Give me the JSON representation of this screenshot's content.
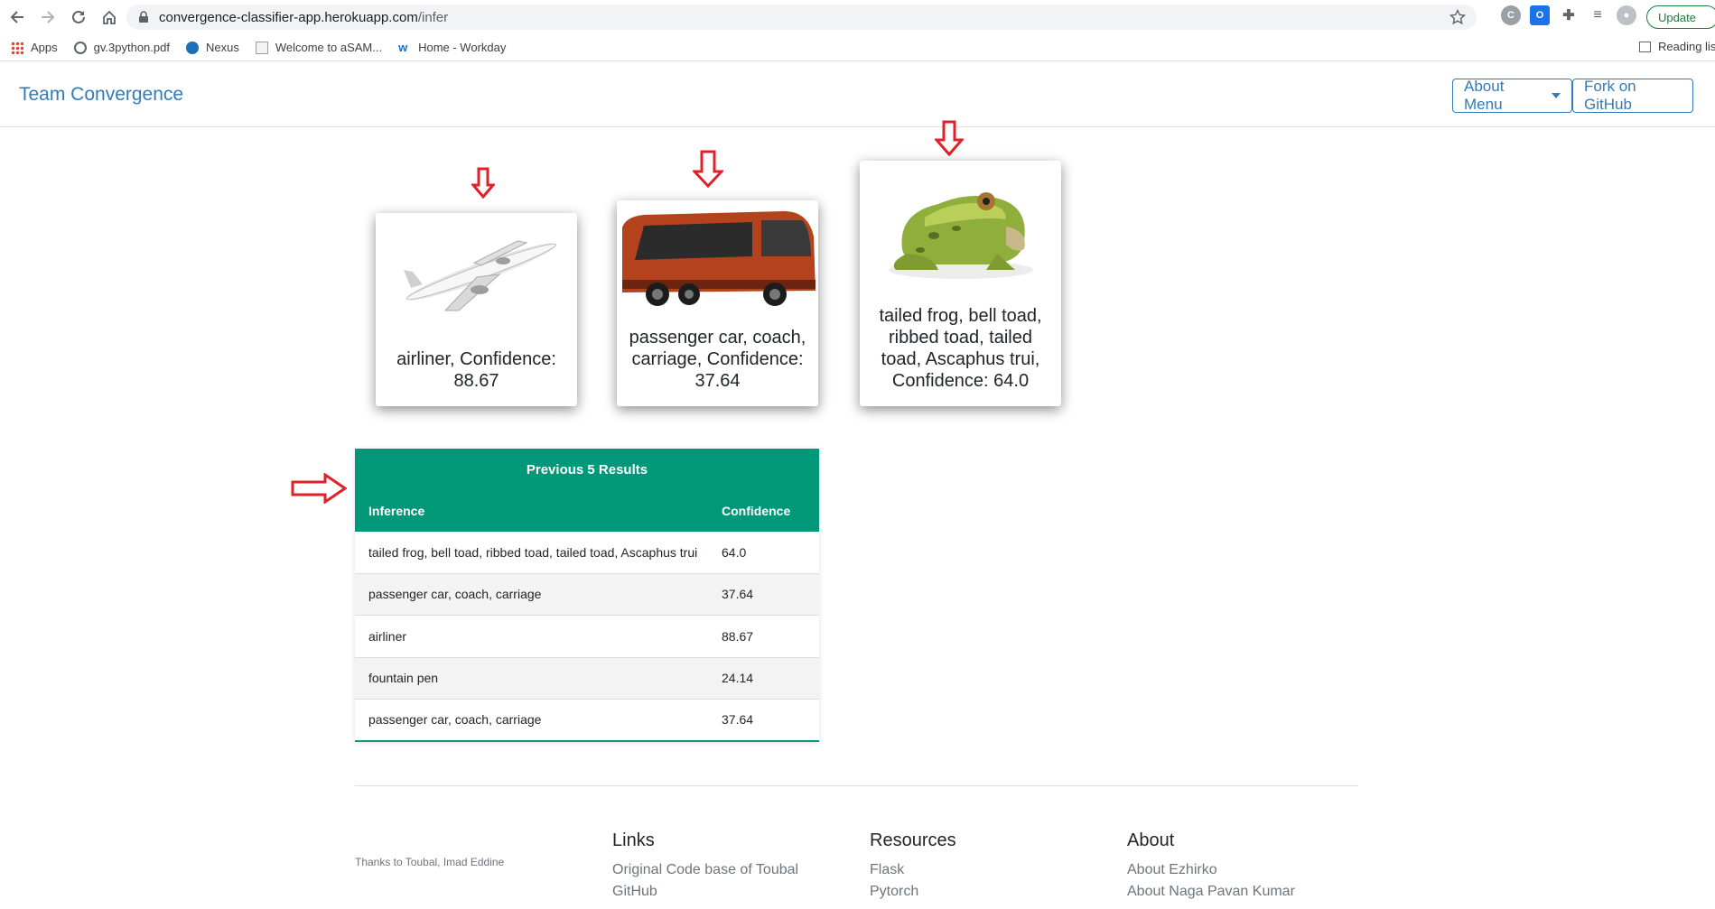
{
  "browser": {
    "url_host": "convergence-classifier-app.herokuapp.com",
    "url_path": "/infer",
    "update_label": "Update",
    "bookmarks": [
      "Apps",
      "gv.3python.pdf",
      "Nexus",
      "Welcome to aSAM...",
      "Home - Workday"
    ],
    "reading_list": "Reading list",
    "colors": {
      "update": "#188038"
    }
  },
  "navbar": {
    "brand": "Team Convergence",
    "about_menu": "About Menu",
    "fork": "Fork on GitHub",
    "accent": "#337ab7"
  },
  "cards": [
    {
      "image": "airliner-image",
      "caption": "airliner, Confidence: 88.67"
    },
    {
      "image": "bus-image",
      "caption": "passenger car, coach, carriage, Confidence: 37.64"
    },
    {
      "image": "frog-image",
      "caption": "tailed frog, bell toad, ribbed toad, tailed toad, Ascaphus trui, Confidence: 64.0"
    }
  ],
  "results": {
    "title": "Previous 5 Results",
    "col_inference": "Inference",
    "col_confidence": "Confidence",
    "header_color": "#009879",
    "rows": [
      {
        "inference": "tailed frog, bell toad, ribbed toad, tailed toad, Ascaphus trui",
        "confidence": "64.0"
      },
      {
        "inference": "passenger car, coach, carriage",
        "confidence": "37.64"
      },
      {
        "inference": "airliner",
        "confidence": "88.67"
      },
      {
        "inference": "fountain pen",
        "confidence": "24.14"
      },
      {
        "inference": "passenger car, coach, carriage",
        "confidence": "37.64"
      }
    ]
  },
  "footer": {
    "thanks": "Thanks to Toubal, Imad Eddine",
    "links": {
      "heading": "Links",
      "items": [
        "Original Code base of Toubal",
        "GitHub"
      ]
    },
    "resources": {
      "heading": "Resources",
      "items": [
        "Flask",
        "Pytorch"
      ]
    },
    "about": {
      "heading": "About",
      "items": [
        "About Ezhirko",
        "About Naga Pavan Kumar"
      ]
    }
  },
  "annotations": {
    "arrow_color": "#e0202a"
  }
}
